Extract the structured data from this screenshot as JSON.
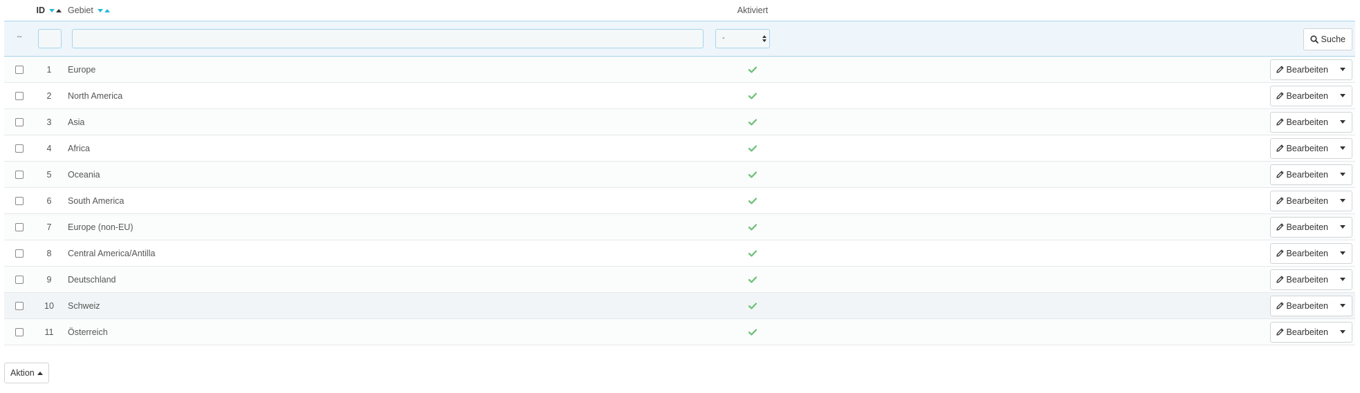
{
  "table": {
    "columns": {
      "id": "ID",
      "name": "Gebiet",
      "active": "Aktiviert"
    },
    "filters": {
      "dash": "--",
      "id_value": "",
      "name_value": "",
      "active_selected": "-",
      "search_label": "Suche"
    },
    "rows": [
      {
        "id": "1",
        "name": "Europe",
        "active": "check-icon",
        "edit_label": "Bearbeiten"
      },
      {
        "id": "2",
        "name": "North America",
        "active": "check-icon",
        "edit_label": "Bearbeiten"
      },
      {
        "id": "3",
        "name": "Asia",
        "active": "check-icon",
        "edit_label": "Bearbeiten"
      },
      {
        "id": "4",
        "name": "Africa",
        "active": "check-icon",
        "edit_label": "Bearbeiten"
      },
      {
        "id": "5",
        "name": "Oceania",
        "active": "check-icon",
        "edit_label": "Bearbeiten"
      },
      {
        "id": "6",
        "name": "South America",
        "active": "check-icon",
        "edit_label": "Bearbeiten"
      },
      {
        "id": "7",
        "name": "Europe (non-EU)",
        "active": "check-icon",
        "edit_label": "Bearbeiten"
      },
      {
        "id": "8",
        "name": "Central America/Antilla",
        "active": "check-icon",
        "edit_label": "Bearbeiten"
      },
      {
        "id": "9",
        "name": "Deutschland",
        "active": "check-icon",
        "edit_label": "Bearbeiten"
      },
      {
        "id": "10",
        "name": "Schweiz",
        "active": "check-icon",
        "edit_label": "Bearbeiten"
      },
      {
        "id": "11",
        "name": "Österreich",
        "active": "check-icon",
        "edit_label": "Bearbeiten"
      }
    ]
  },
  "bulk": {
    "label": "Aktion"
  },
  "colors": {
    "accent": "#25b9d7",
    "check": "#72c279",
    "filter_bg": "#eef5fb",
    "filter_border": "#a6d5ec"
  }
}
